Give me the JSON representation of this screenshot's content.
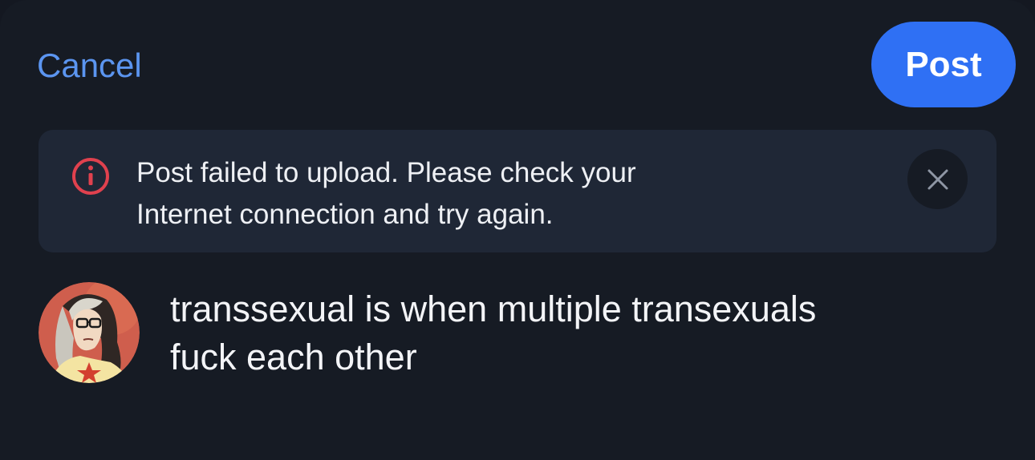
{
  "header": {
    "cancel_label": "Cancel",
    "post_label": "Post"
  },
  "error": {
    "line1": "Post failed to upload. Please check your",
    "line2": "Internet connection and try again.",
    "icon": "info-circle-icon",
    "dismiss_icon": "close-icon"
  },
  "composer": {
    "avatar": "avatar",
    "text_line1": "transsexual is when multiple transexuals",
    "text_line2": "fuck each other"
  },
  "colors": {
    "background": "#161b24",
    "accent": "#2f70f4",
    "link": "#5b95f0",
    "error": "#e0414e",
    "banner": "#1f2736"
  }
}
